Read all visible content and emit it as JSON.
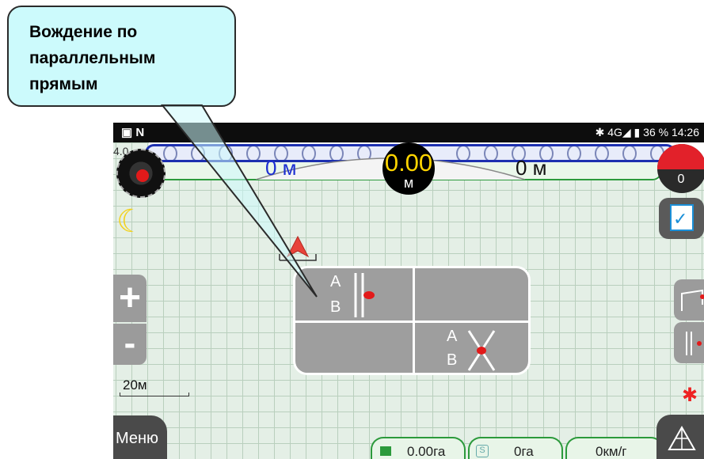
{
  "callout": {
    "line1": "Вождение по",
    "line2": "параллельным",
    "line3": "прямым"
  },
  "status_bar": {
    "left_icons": "▣ N",
    "right_text": "✱ 4G◢ ▮ 36 %  14:26"
  },
  "guidance": {
    "speed_value": "0.00",
    "speed_unit": "м",
    "distance_left": "0 м",
    "distance_right": "0 м",
    "compass_label": "4.0",
    "record_counter": "0"
  },
  "modes": {
    "ab_line": {
      "a": "A",
      "b": "B"
    },
    "ab_curve": {
      "a": "A",
      "b": "B"
    }
  },
  "scale": {
    "label": "20м"
  },
  "menu": {
    "label": "Меню"
  },
  "info": {
    "area_worked": "0.00га",
    "area_total": "0га",
    "speed": "0км/г"
  },
  "colors": {
    "accent_blue": "#1c2fb0",
    "accent_green": "#2c9a3c",
    "marker_red": "#e21a1a",
    "speed_yellow": "#ffd500"
  },
  "icons": [
    "compass-icon",
    "moon-icon",
    "checklist-icon",
    "navigation-arrow-icon",
    "bluetooth-icon",
    "area-icon",
    "flag-icon"
  ]
}
